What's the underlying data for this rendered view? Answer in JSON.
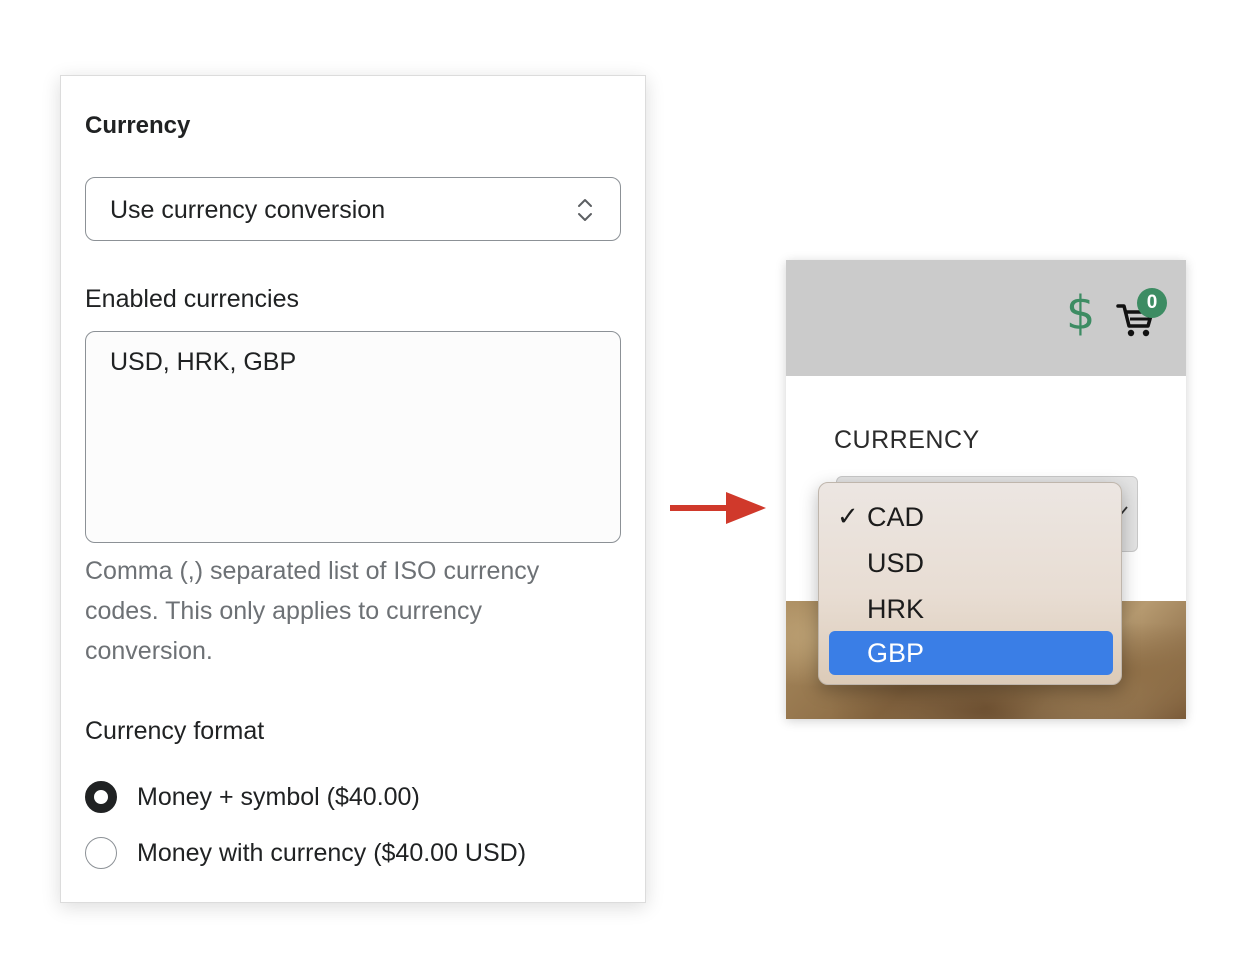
{
  "settings": {
    "section_title": "Currency",
    "conversion_select": {
      "value": "Use currency conversion"
    },
    "enabled_currencies": {
      "label": "Enabled currencies",
      "value": "USD, HRK, GBP",
      "help_text": "Comma (,) separated list of ISO currency codes. This only applies to currency conversion."
    },
    "currency_format": {
      "label": "Currency format",
      "options": [
        {
          "label": "Money + symbol ($40.00)",
          "checked": true
        },
        {
          "label": "Money with currency ($40.00 USD)",
          "checked": false
        }
      ]
    }
  },
  "preview": {
    "header": {
      "currency_symbol": "$",
      "cart_count": "0"
    },
    "currency_label": "CURRENCY",
    "dropdown": {
      "options": [
        {
          "label": "CAD",
          "check": "✓",
          "highlighted": false
        },
        {
          "label": "USD",
          "check": "",
          "highlighted": false
        },
        {
          "label": "HRK",
          "check": "",
          "highlighted": false
        },
        {
          "label": "GBP",
          "check": "",
          "highlighted": true
        }
      ]
    }
  },
  "colors": {
    "accent_green": "#3d8c63",
    "highlight_blue": "#3a7ee6",
    "arrow_red": "#d0392b",
    "text_primary": "#202223",
    "text_muted": "#6d7175"
  },
  "icons": [
    "up-down-chevron-icon",
    "dollar-icon",
    "cart-icon",
    "arrow-right-icon",
    "checkmark-icon"
  ]
}
